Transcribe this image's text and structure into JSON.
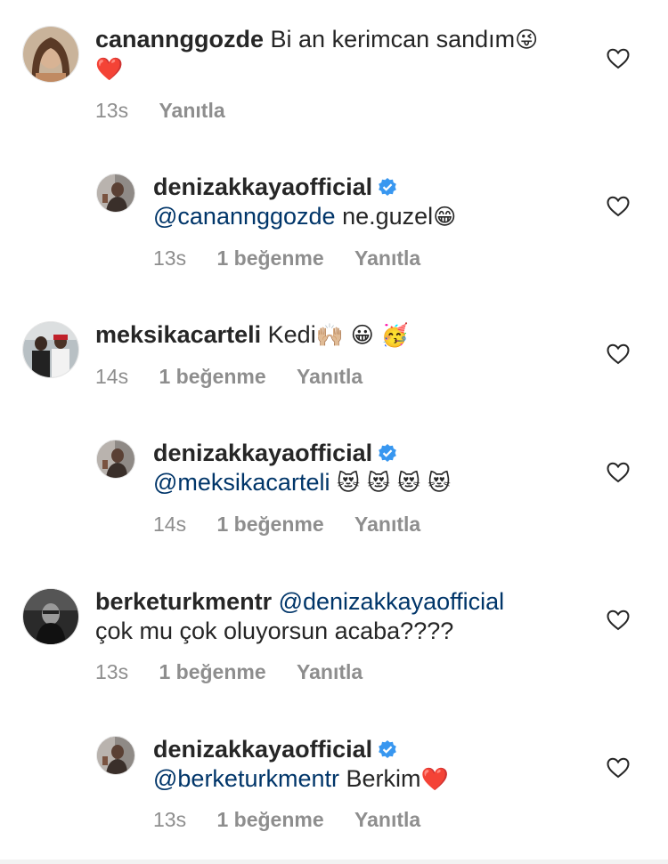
{
  "comments": [
    {
      "username": "canannggozde",
      "text": "Bi an kerimcan sandım",
      "emoji": "😜",
      "emoji2": "❤️",
      "time": "13s",
      "likes": "",
      "reply_label": "Yanıtla"
    },
    {
      "username": "denizakkayaofficial",
      "verified": true,
      "mention": "@canannggozde",
      "text": "ne.guzel",
      "emoji": "😁",
      "time": "13s",
      "likes": "1 beğenme",
      "reply_label": "Yanıtla"
    },
    {
      "username": "meksikacarteli",
      "text": "Kedi",
      "emoji": "🙌🏼 😀 🥳",
      "time": "14s",
      "likes": "1 beğenme",
      "reply_label": "Yanıtla"
    },
    {
      "username": "denizakkayaofficial",
      "verified": true,
      "mention": "@meksikacarteli",
      "emoji": "😻 😻 😻 😻",
      "time": "14s",
      "likes": "1 beğenme",
      "reply_label": "Yanıtla"
    },
    {
      "username": "berketurkmentr",
      "mention": "@denizakkayaofficial",
      "text": "çok mu çok oluyorsun acaba????",
      "time": "13s",
      "likes": "1 beğenme",
      "reply_label": "Yanıtla"
    },
    {
      "username": "denizakkayaofficial",
      "verified": true,
      "mention": "@berketurkmentr",
      "text": "Berkim",
      "emoji": "❤️",
      "time": "13s",
      "likes": "1 beğenme",
      "reply_label": "Yanıtla"
    }
  ],
  "icons": {
    "like": "heart-outline-icon",
    "verified": "verified-badge-icon"
  },
  "colors": {
    "text": "#262626",
    "meta": "#8e8e8e",
    "mention": "#003569",
    "verified": "#3897f0"
  }
}
